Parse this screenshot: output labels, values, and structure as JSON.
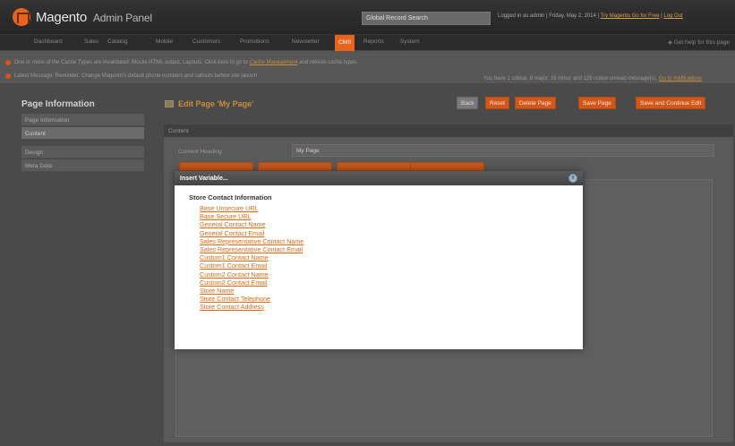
{
  "header": {
    "logo_text": "Magento",
    "logo_sub": "Admin Panel",
    "global_search": "Global Record Search",
    "logged_in": "Logged in as admin | Friday, May 2, 2014 |",
    "try_link": "Try Magento Go for Free",
    "logout": "Log Out"
  },
  "nav": {
    "items": [
      "Dashboard",
      "Sales",
      "Catalog",
      "Mobile",
      "Customers",
      "Promotions",
      "Newsletter",
      "CMS",
      "Reports",
      "System"
    ],
    "active": "CMS",
    "help": "Get help for this page"
  },
  "messages": {
    "line1": "One or more of the Cache Types are invalidated: Blocks HTML output, Layouts. Click here to go to",
    "line1_link": "Cache Management",
    "line1_end": "and refresh cache types.",
    "line2": "Latest Message: Reminder: Change Magento's default phone numbers and callouts before site launch",
    "right": "You have 1 critical, 8 major, 16 minor and 126 notice unread message(s).",
    "right_link": "Go to notifications"
  },
  "sidebar": {
    "title": "Page Information",
    "tabs": [
      "Page Information",
      "Content",
      "Design",
      "Meta Data"
    ],
    "active": "Content"
  },
  "main": {
    "title": "Edit Page 'My Page'",
    "buttons": {
      "back": "Back",
      "reset": "Reset",
      "delete": "Delete Page",
      "save": "Save Page",
      "save_continue": "Save and Continue Edit"
    },
    "section": "Content",
    "content_heading_label": "Content Heading",
    "content_heading_value": "My Page"
  },
  "dialog": {
    "title": "Insert Variable...",
    "close": "x",
    "group": "Store Contact Information",
    "variables": [
      "Base Unsecure URL",
      "Base Secure URL",
      "General Contact Name",
      "General Contact Email",
      "Sales Representative Contact Name",
      "Sales Representative Contact Email",
      "Custom1 Contact Name",
      "Custom1 Contact Email",
      "Custom2 Contact Name",
      "Custom2 Contact Email",
      "Store Name",
      "Store Contact Telephone",
      "Store Contact Address"
    ]
  },
  "colors": {
    "accent": "#e8641c",
    "link": "#e06a12"
  }
}
